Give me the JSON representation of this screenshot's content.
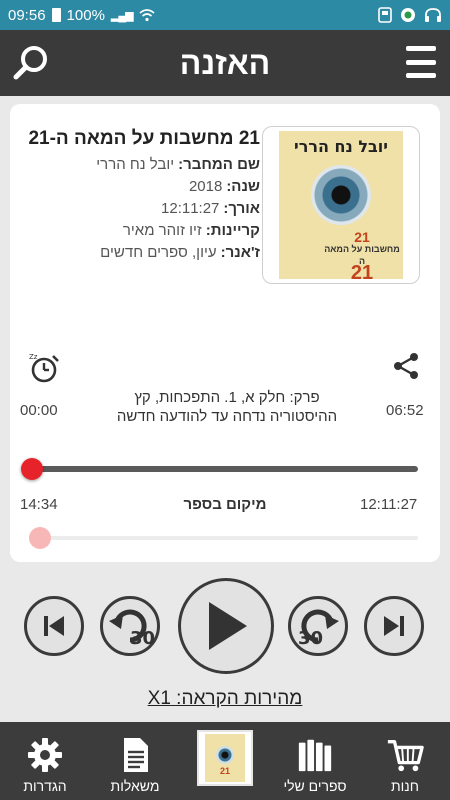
{
  "status_bar": {
    "time": "09:56",
    "battery": "100%"
  },
  "header": {
    "title": "האזנה"
  },
  "book": {
    "title": "21 מחשבות על המאה ה-21",
    "cover_author": "יובל נח הררי",
    "cover_number": "21",
    "cover_subtitle": "מחשבות על המאה ה",
    "cover_number_2": "21",
    "author_label": "שם המחבר:",
    "author": "יובל נח הררי",
    "year_label": "שנה:",
    "year": "2018",
    "length_label": "אורך:",
    "length": "12:11:27",
    "narrator_label": "קריינות:",
    "narrator": "זיו זוהר מאיר",
    "genre_label": "ז'אנר:",
    "genre": "עיון, ספרים חדשים"
  },
  "chapter": {
    "text": "פרק: חלק א, 1. התפכחות, קץ ההיסטוריה נדחה עד להודעה חדשה",
    "elapsed": "00:00",
    "duration": "06:52",
    "progress": 0.0
  },
  "book_position": {
    "label": "מיקום בספר",
    "elapsed": "14:34",
    "total": "12:11:27",
    "progress": 0.02
  },
  "controls": {
    "skip_back_seconds": "30",
    "skip_forward_seconds": "30"
  },
  "speed": {
    "text": "מהירות הקראה: X1"
  },
  "nav": {
    "settings": "הגדרות",
    "loans": "משאלות",
    "my_books": "ספרים שלי",
    "store": "חנות"
  },
  "colors": {
    "accent": "#2d8aa4",
    "progress_thumb": "#e6232a",
    "dark_bar": "#3a3a3a"
  }
}
